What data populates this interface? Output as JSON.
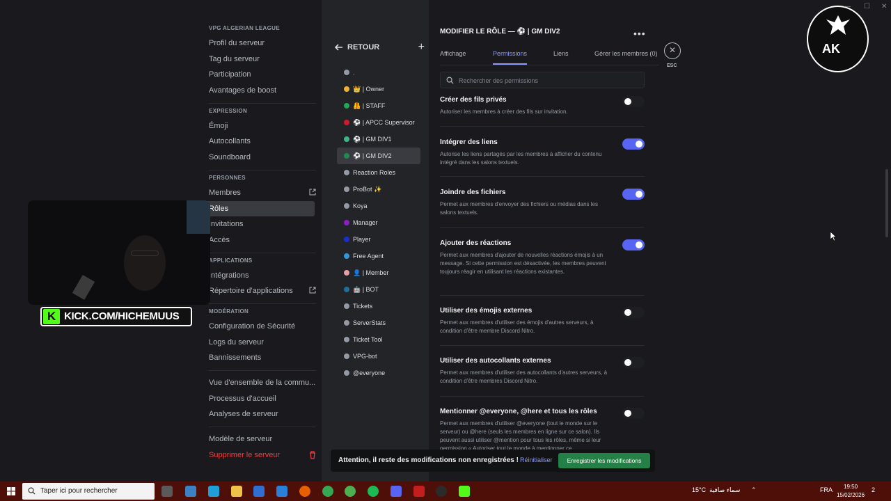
{
  "nav": {
    "sections": [
      {
        "heading": "VPG ALGERIAN LEAGUE",
        "items": [
          "Profil du serveur",
          "Tag du serveur",
          "Participation",
          "Avantages de boost"
        ]
      },
      {
        "heading": "EXPRESSION",
        "items": [
          "Émoji",
          "Autocollants",
          "Soundboard"
        ]
      },
      {
        "heading": "PERSONNES",
        "items": [
          "Membres",
          "Rôles",
          "Invitations",
          "Accès"
        ]
      },
      {
        "heading": "APPLICATIONS",
        "items": [
          "Intégrations",
          "Répertoire d'applications"
        ]
      },
      {
        "heading": "MODÉRATION",
        "items": [
          "Configuration de Sécurité",
          "Logs du serveur",
          "Bannissements"
        ]
      }
    ],
    "extra": [
      "Vue d'ensemble de la commu...",
      "Processus d'accueil",
      "Analyses de serveur"
    ],
    "template": "Modèle de serveur",
    "delete": "Supprimer le serveur"
  },
  "roles_panel": {
    "back": "RETOUR",
    "plus": "+",
    "roles": [
      {
        "label": ".",
        "color": "#949ba4"
      },
      {
        "label": "👑 | Owner",
        "color": "#f0b232"
      },
      {
        "label": "🦺 | STAFF",
        "color": "#23a55a"
      },
      {
        "label": "⚽ | APCC Supervisor",
        "color": "#d11a2a"
      },
      {
        "label": "⚽ | GM DIV1",
        "color": "#43b581"
      },
      {
        "label": "⚽ | GM DIV2",
        "color": "#1f8b4c"
      },
      {
        "label": "Reaction Roles",
        "color": "#949ba4"
      },
      {
        "label": "ProBot ✨",
        "color": "#949ba4"
      },
      {
        "label": "Koya",
        "color": "#949ba4"
      },
      {
        "label": "Manager",
        "color": "#8b1fc7"
      },
      {
        "label": "Player",
        "color": "#1b2ecf"
      },
      {
        "label": "Free Agent",
        "color": "#3498db"
      },
      {
        "label": "👤 | Member",
        "color": "#e8a0a8"
      },
      {
        "label": "🤖 | BOT",
        "color": "#1f6f9b"
      },
      {
        "label": "Tickets",
        "color": "#949ba4"
      },
      {
        "label": "ServerStats",
        "color": "#949ba4"
      },
      {
        "label": "Ticket Tool",
        "color": "#949ba4"
      },
      {
        "label": "VPG-bot",
        "color": "#949ba4"
      },
      {
        "label": "@everyone",
        "color": "#949ba4"
      }
    ]
  },
  "edit": {
    "title": "MODIFIER LE RÔLE — ⚽ | GM DIV2",
    "menu": "•••",
    "tabs": [
      "Affichage",
      "Permissions",
      "Liens",
      "Gérer les membres (0)"
    ],
    "esc": "ESC",
    "close": "✕",
    "search_placeholder": "Rechercher des permissions",
    "permissions": [
      {
        "title": "Créer des fils privés",
        "desc": "Autoriser les membres à créer des fils sur invitation.",
        "on": false
      },
      {
        "title": "Intégrer des liens",
        "desc": "Autorise les liens partagés par les membres à afficher du contenu intégré dans les salons textuels.",
        "on": true
      },
      {
        "title": "Joindre des fichiers",
        "desc": "Permet aux membres d'envoyer des fichiers ou médias dans les salons textuels.",
        "on": true
      },
      {
        "title": "Ajouter des réactions",
        "desc": "Permet aux membres d'ajouter de nouvelles réactions émojis à un message. Si cette permission est désactivée, les membres peuvent toujours réagir en utilisant les réactions existantes.",
        "on": true
      },
      {
        "title": "Utiliser des émojis externes",
        "desc": "Permet aux membres d'utiliser des émojis d'autres serveurs, à condition d'être membre Discord Nitro.",
        "on": false
      },
      {
        "title": "Utiliser des autocollants externes",
        "desc": "Permet aux membres d'utiliser des autocollants d'autres serveurs, à condition d'être membres Discord Nitro.",
        "on": false
      },
      {
        "title": "Mentionner @everyone, @here et tous les rôles",
        "desc": "Permet aux membres d'utiliser @everyone (tout le monde sur le serveur) ou @here (seuls les membres en ligne sur ce salon). Ils peuvent aussi utiliser @mention pour tous les rôles, même si leur permission « Autoriser tout le monde à mentionner ce",
        "on": false
      }
    ]
  },
  "unsaved": {
    "text": "Attention, il reste des modifications non enregistrées !",
    "reset": "Réinitialiser",
    "save": "Enregistrer les modifications"
  },
  "overlay": {
    "kick_k": "K",
    "kick_text": "KICK.COM/HICHEMUUS",
    "logo": "AK"
  },
  "taskbar": {
    "search": "Taper ici pour rechercher",
    "temp": "15°C",
    "weather": "سماء صافية",
    "lang": "FRA",
    "time": "19:50",
    "date": "15/02/2026",
    "notif": "2"
  }
}
